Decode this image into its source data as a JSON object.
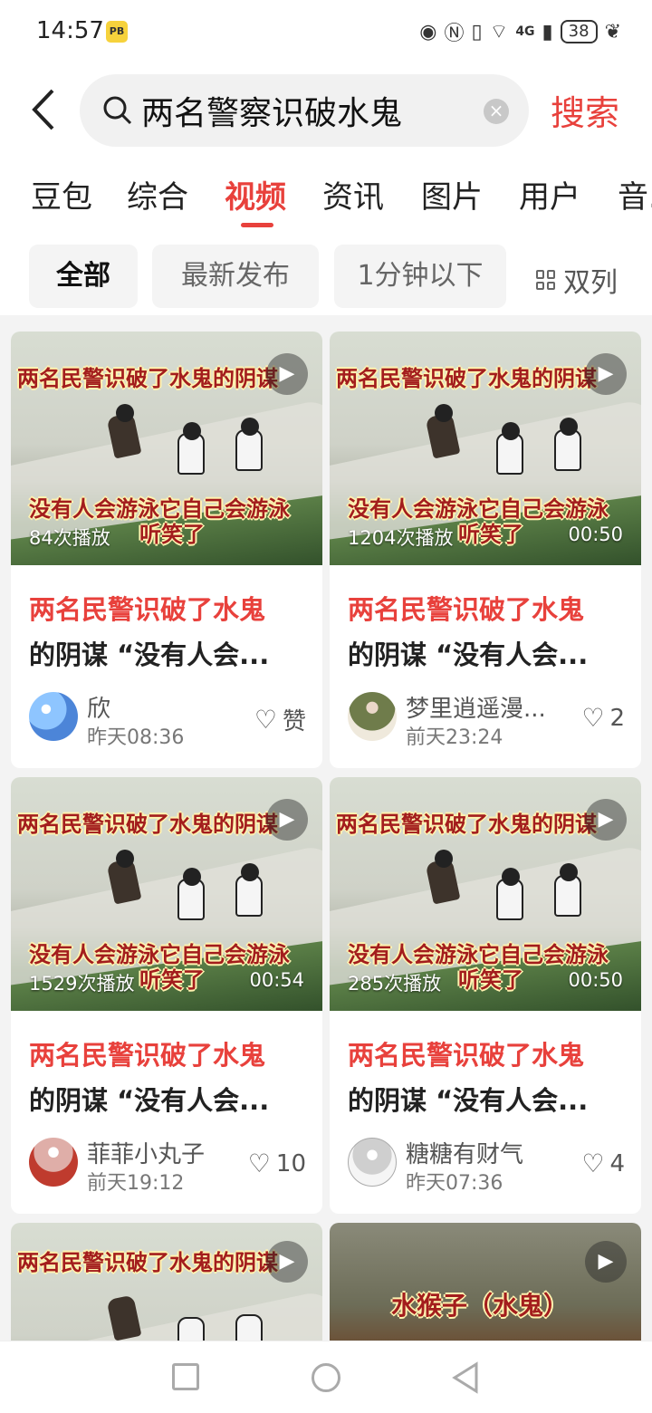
{
  "status": {
    "time": "14:57",
    "app_badge": "PB",
    "network": "4G",
    "battery": "38"
  },
  "search": {
    "query": "两名警察识破水鬼",
    "button": "搜索"
  },
  "tabs": [
    "豆包",
    "综合",
    "视频",
    "资讯",
    "图片",
    "用户",
    "音..."
  ],
  "filters": {
    "all": "全部",
    "latest": "最新发布",
    "duration": "1分钟以下",
    "layout": "双列"
  },
  "cards": [
    {
      "caption_top": "两名民警识破了水鬼的阴谋",
      "caption_bottom": "没有人会游泳它自己会游泳",
      "caption_bottom2": "听笑了",
      "plays": "84次播放",
      "duration": "",
      "title_red": "两名民警识破了水鬼",
      "title_rest": "的阴谋 “没有人会...",
      "author": "欣",
      "time": "昨天08:36",
      "likes": "赞"
    },
    {
      "caption_top": "两名民警识破了水鬼的阴谋",
      "caption_bottom": "没有人会游泳它自己会游泳",
      "caption_bottom2": "听笑了",
      "plays": "1204次播放",
      "duration": "00:50",
      "title_red": "两名民警识破了水鬼",
      "title_rest": "的阴谋 “没有人会...",
      "author": "梦里逍遥漫...",
      "time": "前天23:24",
      "likes": "2"
    },
    {
      "caption_top": "两名民警识破了水鬼的阴谋",
      "caption_bottom": "没有人会游泳它自己会游泳",
      "caption_bottom2": "听笑了",
      "plays": "1529次播放",
      "duration": "00:54",
      "title_red": "两名民警识破了水鬼",
      "title_rest": "的阴谋 “没有人会...",
      "author": "菲菲小丸子",
      "time": "前天19:12",
      "likes": "10"
    },
    {
      "caption_top": "两名民警识破了水鬼的阴谋",
      "caption_bottom": "没有人会游泳它自己会游泳",
      "caption_bottom2": "听笑了",
      "plays": "285次播放",
      "duration": "00:50",
      "title_red": "两名民警识破了水鬼",
      "title_rest": "的阴谋 “没有人会...",
      "author": "糖糖有财气",
      "time": "昨天07:36",
      "likes": "4"
    },
    {
      "caption_top": "两名民警识破了水鬼的阴谋"
    },
    {
      "caption_top": "水猴子（水鬼）"
    }
  ],
  "icons": {
    "play": "play-icon",
    "heart": "heart-outline-icon"
  },
  "colors": {
    "accent": "#e8413c",
    "background": "#f3f3f3"
  }
}
